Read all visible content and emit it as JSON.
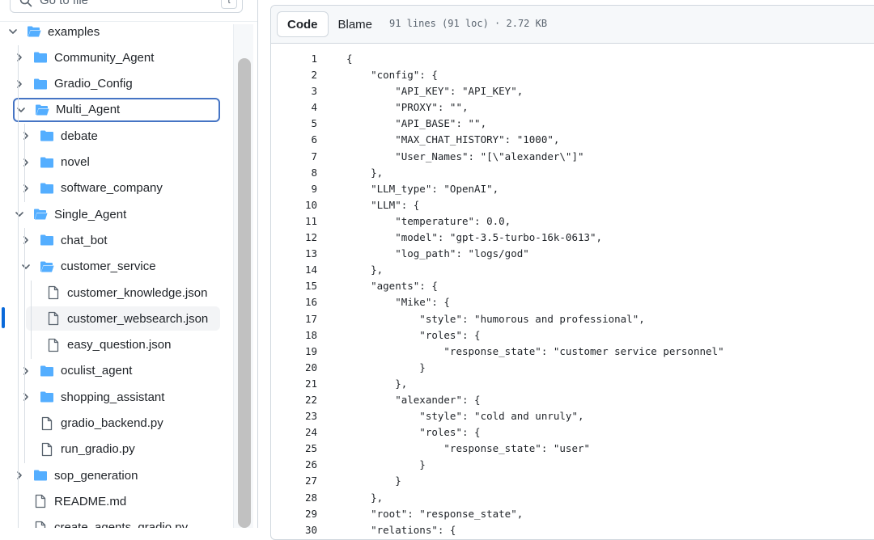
{
  "search": {
    "placeholder": "Go to file",
    "shortcut": "t"
  },
  "tree": [
    {
      "label": "examples",
      "type": "folder",
      "open": true,
      "depth": 0
    },
    {
      "label": "Community_Agent",
      "type": "folder",
      "open": false,
      "depth": 1
    },
    {
      "label": "Gradio_Config",
      "type": "folder",
      "open": false,
      "depth": 1
    },
    {
      "label": "Multi_Agent",
      "type": "folder",
      "open": true,
      "depth": 1,
      "selected": true
    },
    {
      "label": "debate",
      "type": "folder",
      "open": false,
      "depth": 2
    },
    {
      "label": "novel",
      "type": "folder",
      "open": false,
      "depth": 2
    },
    {
      "label": "software_company",
      "type": "folder",
      "open": false,
      "depth": 2
    },
    {
      "label": "Single_Agent",
      "type": "folder",
      "open": true,
      "depth": 1
    },
    {
      "label": "chat_bot",
      "type": "folder",
      "open": false,
      "depth": 2
    },
    {
      "label": "customer_service",
      "type": "folder",
      "open": true,
      "depth": 2
    },
    {
      "label": "customer_knowledge.json",
      "type": "file",
      "depth": 3
    },
    {
      "label": "customer_websearch.json",
      "type": "file",
      "depth": 3,
      "current": true
    },
    {
      "label": "easy_question.json",
      "type": "file",
      "depth": 3
    },
    {
      "label": "oculist_agent",
      "type": "folder",
      "open": false,
      "depth": 2
    },
    {
      "label": "shopping_assistant",
      "type": "folder",
      "open": false,
      "depth": 2
    },
    {
      "label": "gradio_backend.py",
      "type": "file",
      "depth": 2
    },
    {
      "label": "run_gradio.py",
      "type": "file",
      "depth": 2
    },
    {
      "label": "sop_generation",
      "type": "folder",
      "open": false,
      "depth": 1
    },
    {
      "label": "README.md",
      "type": "file",
      "depth": 1
    },
    {
      "label": "create_agents_gradio.py",
      "type": "file",
      "depth": 1
    }
  ],
  "viewer": {
    "code_tab": "Code",
    "blame_tab": "Blame",
    "file_meta": "91 lines (91 loc) · 2.72 KB"
  },
  "code": [
    {
      "n": "1",
      "text": "{"
    },
    {
      "n": "2",
      "text": "    \"config\": {"
    },
    {
      "n": "3",
      "text": "        \"API_KEY\": \"API_KEY\","
    },
    {
      "n": "4",
      "text": "        \"PROXY\": \"\","
    },
    {
      "n": "5",
      "text": "        \"API_BASE\": \"\","
    },
    {
      "n": "6",
      "text": "        \"MAX_CHAT_HISTORY\": \"1000\","
    },
    {
      "n": "7",
      "text": "        \"User_Names\": \"[\\\"alexander\\\"]\""
    },
    {
      "n": "8",
      "text": "    },"
    },
    {
      "n": "9",
      "text": "    \"LLM_type\": \"OpenAI\","
    },
    {
      "n": "10",
      "text": "    \"LLM\": {"
    },
    {
      "n": "11",
      "text": "        \"temperature\": 0.0,"
    },
    {
      "n": "12",
      "text": "        \"model\": \"gpt-3.5-turbo-16k-0613\","
    },
    {
      "n": "13",
      "text": "        \"log_path\": \"logs/god\""
    },
    {
      "n": "14",
      "text": "    },"
    },
    {
      "n": "15",
      "text": "    \"agents\": {"
    },
    {
      "n": "16",
      "text": "        \"Mike\": {"
    },
    {
      "n": "17",
      "text": "            \"style\": \"humorous and professional\","
    },
    {
      "n": "18",
      "text": "            \"roles\": {"
    },
    {
      "n": "19",
      "text": "                \"response_state\": \"customer service personnel\""
    },
    {
      "n": "20",
      "text": "            }"
    },
    {
      "n": "21",
      "text": "        },"
    },
    {
      "n": "22",
      "text": "        \"alexander\": {"
    },
    {
      "n": "23",
      "text": "            \"style\": \"cold and unruly\","
    },
    {
      "n": "24",
      "text": "            \"roles\": {"
    },
    {
      "n": "25",
      "text": "                \"response_state\": \"user\""
    },
    {
      "n": "26",
      "text": "            }"
    },
    {
      "n": "27",
      "text": "        }"
    },
    {
      "n": "28",
      "text": "    },"
    },
    {
      "n": "29",
      "text": "    \"root\": \"response_state\","
    },
    {
      "n": "30",
      "text": "    \"relations\": {"
    }
  ]
}
